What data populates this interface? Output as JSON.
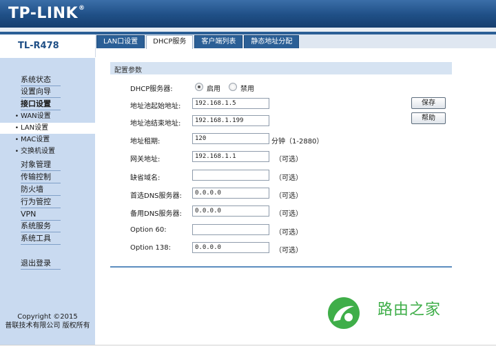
{
  "brand": {
    "logo_text": "TP-LINK",
    "model": "TL-R478"
  },
  "tabs": [
    {
      "label": "LAN口设置",
      "active": false
    },
    {
      "label": "DHCP服务",
      "active": true
    },
    {
      "label": "客户端列表",
      "active": false
    },
    {
      "label": "静态地址分配",
      "active": false
    }
  ],
  "sidebar": {
    "items": [
      {
        "label": "系统状态"
      },
      {
        "label": "设置向导"
      },
      {
        "label": "接口设置"
      },
      {
        "label": "WAN设置"
      },
      {
        "label": "LAN设置"
      },
      {
        "label": "MAC设置"
      },
      {
        "label": "交换机设置"
      },
      {
        "label": "对象管理"
      },
      {
        "label": "传输控制"
      },
      {
        "label": "防火墙"
      },
      {
        "label": "行为管控"
      },
      {
        "label": "VPN"
      },
      {
        "label": "系统服务"
      },
      {
        "label": "系统工具"
      },
      {
        "label": "退出登录"
      }
    ],
    "copyright_line1": "Copyright ©2015",
    "copyright_line2": "普联技术有限公司 版权所有"
  },
  "form": {
    "section_title": "配置参数",
    "dhcp_label": "DHCP服务器:",
    "enable_label": "启用",
    "disable_label": "禁用",
    "dhcp_enabled": true,
    "start_label": "地址池起始地址:",
    "start_value": "192.168.1.5",
    "end_label": "地址池结束地址:",
    "end_value": "192.168.1.199",
    "lease_label": "地址租期:",
    "lease_value": "120",
    "lease_hint": "分钟（1-2880）",
    "gateway_label": "网关地址:",
    "gateway_value": "192.168.1.1",
    "domain_label": "缺省域名:",
    "domain_value": "",
    "dns1_label": "首选DNS服务器:",
    "dns1_value": "0.0.0.0",
    "dns2_label": "备用DNS服务器:",
    "dns2_value": "0.0.0.0",
    "opt60_label": "Option 60:",
    "opt60_value": "",
    "opt138_label": "Option 138:",
    "opt138_value": "0.0.0.0",
    "optional_hint": "（可选）"
  },
  "buttons": {
    "save": "保存",
    "help": "帮助"
  },
  "watermark": {
    "text": "路由之家"
  },
  "colors": {
    "banner": "#1f4f86",
    "sidebar": "#c9daf0",
    "watermark": "#3fae49"
  }
}
